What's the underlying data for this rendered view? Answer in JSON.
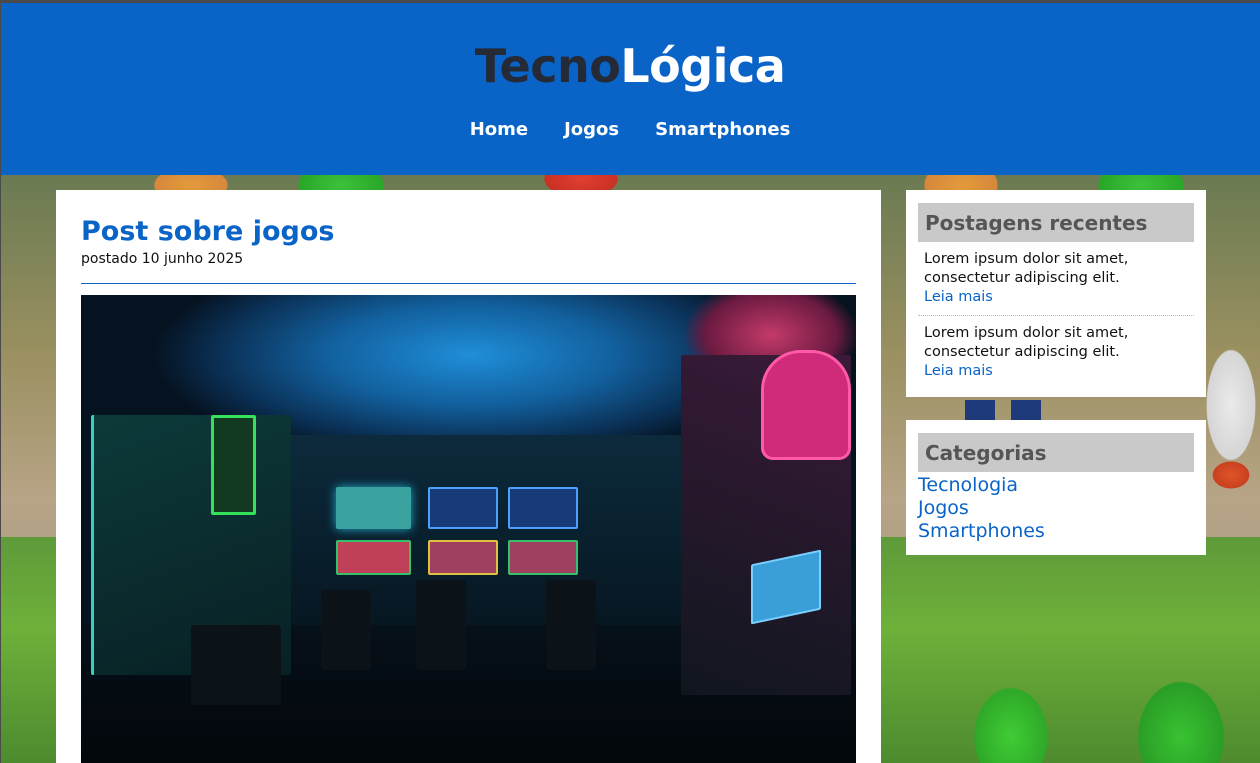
{
  "site": {
    "logo_part1": "Tecno",
    "logo_part2": "Lógica",
    "brand_color": "#0a64c8"
  },
  "nav": {
    "items": [
      {
        "label": "Home"
      },
      {
        "label": "Jogos"
      },
      {
        "label": "Smartphones"
      }
    ]
  },
  "post": {
    "title": "Post sobre jogos",
    "date": "postado 10 junho 2025",
    "image_icon": "arcade-room-photo"
  },
  "sidebar": {
    "recent": {
      "title": "Postagens recentes",
      "items": [
        {
          "text": "Lorem ipsum dolor sit amet, consectetur adipiscing elit.",
          "link": "Leia mais"
        },
        {
          "text": "Lorem ipsum dolor sit amet, consectetur adipiscing elit.",
          "link": "Leia mais"
        }
      ]
    },
    "categories": {
      "title": "Categorias",
      "items": [
        {
          "label": "Tecnologia"
        },
        {
          "label": "Jogos"
        },
        {
          "label": "Smartphones"
        }
      ]
    }
  }
}
